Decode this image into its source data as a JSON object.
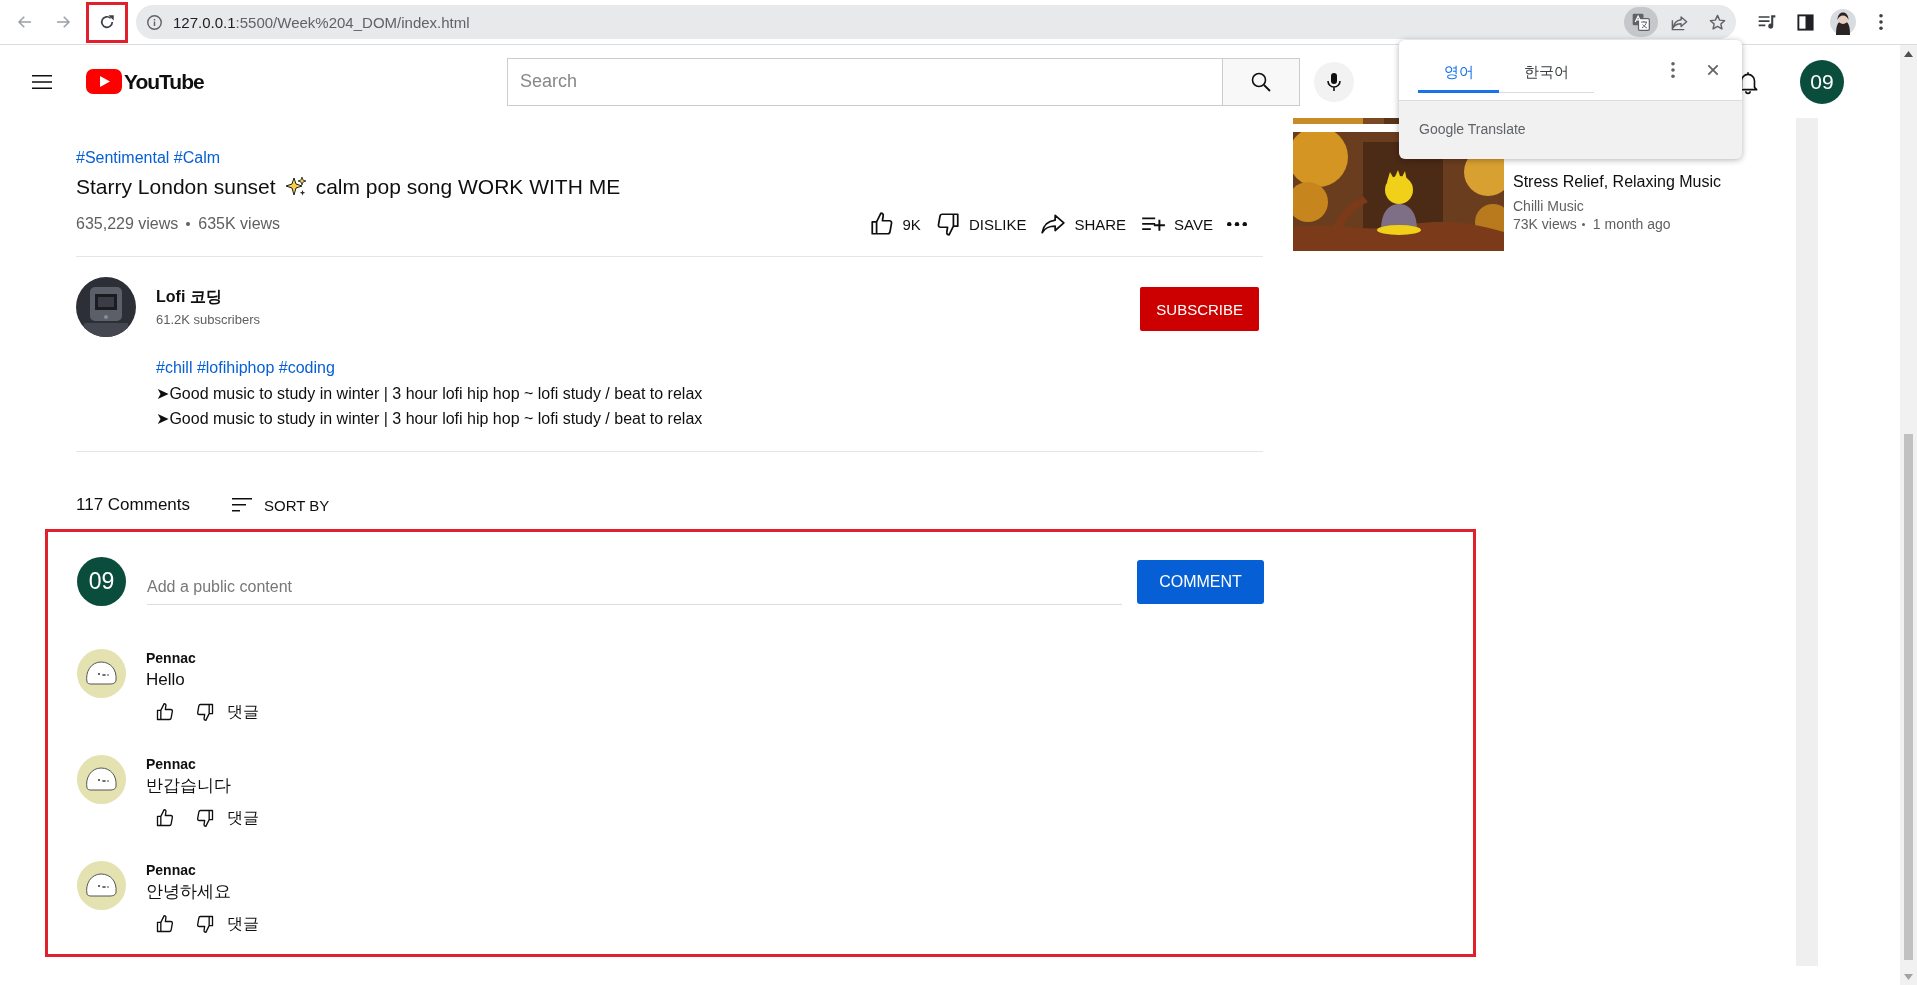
{
  "browser": {
    "url_host": "127.0.0.1",
    "url_path": ":5500/Week%204_DOM/index.html",
    "reload_highlighted": true,
    "translate_active": true
  },
  "header": {
    "logo": "YouTube",
    "search": {
      "placeholder": "Search"
    },
    "avatar": "09"
  },
  "translate_popup": {
    "tabs": [
      {
        "label": "영어",
        "selected": true
      },
      {
        "label": "한국어",
        "selected": false
      }
    ],
    "footer": "Google Translate"
  },
  "video": {
    "hashtags": "#Sentimental #Calm",
    "title": {
      "before": "Starry London sunset",
      "after": "calm pop song WORK WITH ME"
    },
    "views": "635,229 views",
    "views_short": "635K views",
    "actions": [
      {
        "kind": "like",
        "label": "9K"
      },
      {
        "kind": "dislike",
        "label": "DISLIKE"
      },
      {
        "kind": "share",
        "label": "SHARE"
      },
      {
        "kind": "save",
        "label": "SAVE"
      },
      {
        "kind": "more"
      }
    ]
  },
  "channel": {
    "name": "Lofi 코딩",
    "subscribers": "61.2K subscribers",
    "subscribe": "SUBSCRIBE"
  },
  "description": {
    "hashtags": "#chill #lofihiphop #coding",
    "lines": [
      "➤Good music to study in winter | 3 hour lofi hip hop ~ lofi study / beat to relax",
      "➤Good music to study in winter | 3 hour lofi hip hop ~ lofi study / beat to relax"
    ]
  },
  "comments": {
    "count": "117 Comments",
    "sort": "SORT BY",
    "highlighted": true,
    "composer": {
      "avatar": "09",
      "placeholder": "Add a public content",
      "button": "COMMENT"
    },
    "items": [
      {
        "author": "Pennac",
        "text": "Hello",
        "reply": "댓글"
      },
      {
        "author": "Pennac",
        "text": "반갑습니다",
        "reply": "댓글"
      },
      {
        "author": "Pennac",
        "text": "안녕하세요",
        "reply": "댓글"
      }
    ]
  },
  "sidebar": {
    "videos": [
      {
        "title_lines": [
          "Stress Relief, Relaxing Music"
        ],
        "channel": "Chilli Music",
        "views": "73K views",
        "age": "1 month ago"
      }
    ]
  }
}
